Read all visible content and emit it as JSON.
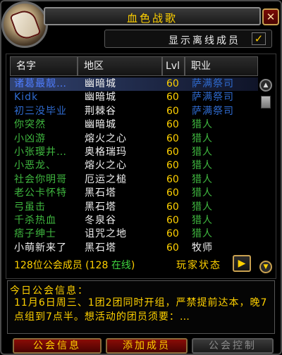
{
  "window": {
    "title": "血色战歌",
    "close_label": "✕"
  },
  "offline": {
    "label": "显示离线成员",
    "checked_mark": "✓"
  },
  "columns": {
    "name": "名字",
    "zone": "地区",
    "level": "Lvl",
    "class": "职业"
  },
  "members": [
    {
      "name": "诸葛最靓…",
      "zone": "幽暗城",
      "level": "60",
      "class": "萨满祭司",
      "name_color": "#4f7dff",
      "class_color": "#2f6bd0"
    },
    {
      "name": "Kidk",
      "zone": "幽暗城",
      "level": "60",
      "class": "萨满祭司",
      "name_color": "#2f6bd0",
      "class_color": "#2f6bd0"
    },
    {
      "name": "初三没毕业",
      "zone": "荆棘谷",
      "level": "60",
      "class": "萨满祭司",
      "name_color": "#2f6bd0",
      "class_color": "#2f6bd0"
    },
    {
      "name": "你突然",
      "zone": "幽暗城",
      "level": "60",
      "class": "猎人",
      "name_color": "#3fb83f",
      "class_color": "#3fb83f"
    },
    {
      "name": "小凶游",
      "zone": "熔火之心",
      "level": "60",
      "class": "猎人",
      "name_color": "#3fb83f",
      "class_color": "#3fb83f"
    },
    {
      "name": "小张璎井…",
      "zone": "奥格瑞玛",
      "level": "60",
      "class": "猎人",
      "name_color": "#3fb83f",
      "class_color": "#3fb83f"
    },
    {
      "name": "小恶龙、",
      "zone": "熔火之心",
      "level": "60",
      "class": "猎人",
      "name_color": "#3fb83f",
      "class_color": "#3fb83f"
    },
    {
      "name": "社会你明哥",
      "zone": "厄运之槌",
      "level": "60",
      "class": "猎人",
      "name_color": "#3fb83f",
      "class_color": "#3fb83f"
    },
    {
      "name": "老公卡怀特",
      "zone": "黑石塔",
      "level": "60",
      "class": "猎人",
      "name_color": "#3fb83f",
      "class_color": "#3fb83f"
    },
    {
      "name": "弓虽击",
      "zone": "黑石塔",
      "level": "60",
      "class": "猎人",
      "name_color": "#3fb83f",
      "class_color": "#3fb83f"
    },
    {
      "name": "千杀热血",
      "zone": "冬泉谷",
      "level": "60",
      "class": "猎人",
      "name_color": "#3fb83f",
      "class_color": "#3fb83f"
    },
    {
      "name": "痞子绅士",
      "zone": "诅咒之地",
      "level": "60",
      "class": "猎人",
      "name_color": "#3fb83f",
      "class_color": "#3fb83f"
    },
    {
      "name": "小萌新来了",
      "zone": "黑石塔",
      "level": "60",
      "class": "牧师",
      "name_color": "#f0f0f0",
      "class_color": "#f0f0f0"
    }
  ],
  "summary": {
    "count_text": "128位公会成员 (128 ",
    "online_text": "在线",
    "close_paren": ")"
  },
  "player_status": {
    "label": "玩家状态",
    "arrow": "▶"
  },
  "motd": {
    "title": "今日公会信息：",
    "text": "11月6日周三、1团2团同时开组，严禁提前达本，晚7点组到7点半。想活动的团员须要：…"
  },
  "buttons": {
    "guild_info": "公会信息",
    "add_member": "添加成员",
    "guild_control": "公会控制"
  },
  "scroll": {
    "up": "▲",
    "down": "▼"
  }
}
